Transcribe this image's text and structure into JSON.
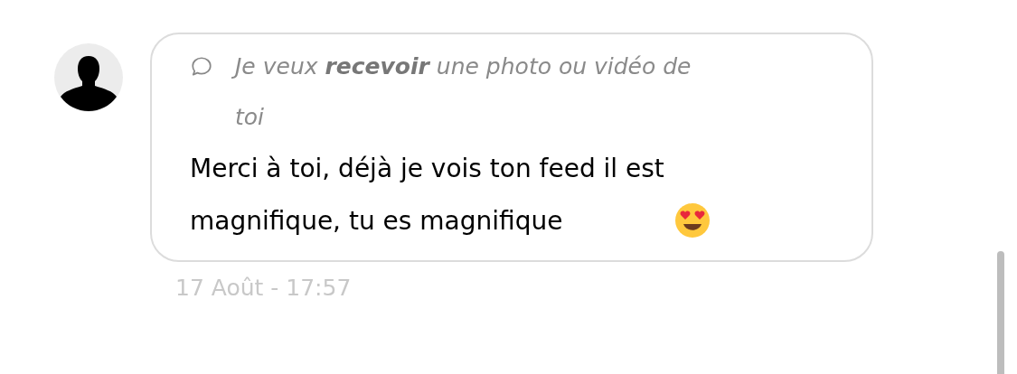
{
  "message": {
    "quote": "Je veux **recevoir** une photo ou vidéo de toi",
    "text": "Merci à toi, déjà je vois ton feed il est magnifique, tu es magnifique",
    "time": "17 Août - 17:57"
  }
}
